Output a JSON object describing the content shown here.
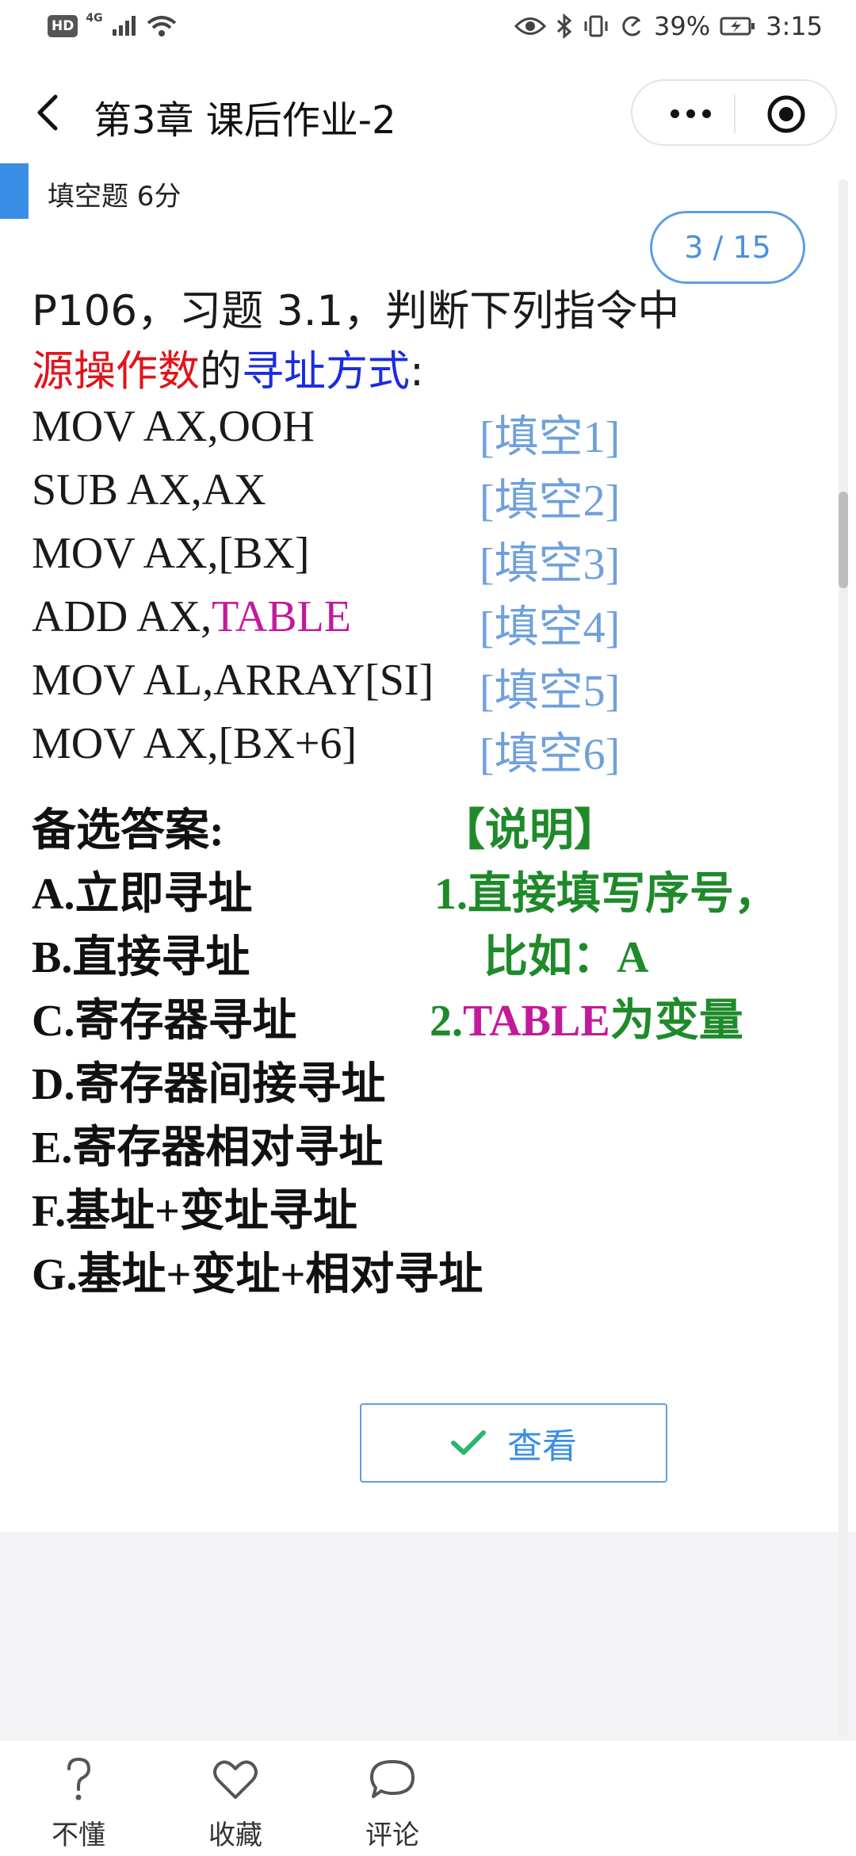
{
  "status_bar": {
    "hd": "HD",
    "network": "4G",
    "battery": "39%",
    "time": "3:15"
  },
  "nav": {
    "title": "第3章 课后作业-2"
  },
  "question": {
    "type_label": "填空题 6分",
    "pager": "3 / 15",
    "prompt_line1": "P106，习题 3.1，判断下列指令中",
    "prompt_red": "源操作数",
    "prompt_mid": "的",
    "prompt_blue": "寻址方式",
    "prompt_end": ":",
    "instructions": [
      {
        "op": "MOV AX,OOH",
        "hl": "",
        "blank": "[填空1]"
      },
      {
        "op": "SUB AX,AX",
        "hl": "",
        "blank": "[填空2]"
      },
      {
        "op": "MOV AX,[BX]",
        "hl": "",
        "blank": "[填空3]"
      },
      {
        "op": "ADD AX,",
        "hl": "TABLE",
        "blank": "[填空4]"
      },
      {
        "op": "MOV AL,ARRAY[SI]",
        "hl": "",
        "blank": "[填空5]"
      },
      {
        "op": "MOV AX,[BX+6]",
        "hl": "",
        "blank": "[填空6]"
      }
    ],
    "options_title": "备选答案:",
    "options": [
      "A.立即寻址",
      "B.直接寻址",
      "C.寄存器寻址",
      "D.寄存器间接寻址",
      "E.寄存器相对寻址",
      "F.基址+变址寻址",
      "G.基址+变址+相对寻址"
    ],
    "note_title": "【说明】",
    "note_1": "1.直接填写序号，",
    "note_1b": "比如：A",
    "note_2_num": "2.",
    "note_2_hl": "TABLE",
    "note_2_rest": "为变量"
  },
  "view_button": {
    "label": "查看"
  },
  "bottom_bar": {
    "items": [
      {
        "label": "不懂",
        "icon": "question-icon"
      },
      {
        "label": "收藏",
        "icon": "heart-icon"
      },
      {
        "label": "评论",
        "icon": "comment-icon"
      }
    ]
  },
  "colors": {
    "accent": "#3a8ee6",
    "red": "#e0141a",
    "blue": "#1b2be0",
    "magenta": "#c21a9b",
    "green": "#1e8a2a",
    "blank": "#6fa0dc"
  }
}
